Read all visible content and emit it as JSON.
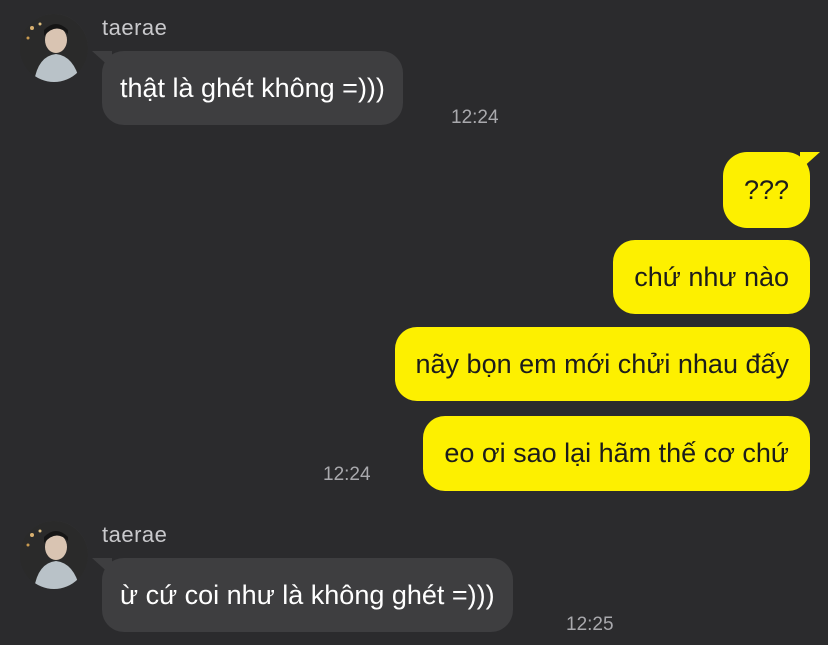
{
  "colors": {
    "background": "#2b2b2d",
    "incoming_bubble": "#3e3e40",
    "outgoing_bubble": "#fdf000"
  },
  "messages": {
    "group1": {
      "sender": "taerae",
      "avatar_icon": "profile-photo",
      "text": "thật là ghét không =)))",
      "time": "12:24"
    },
    "outgoing": {
      "items": [
        "???",
        "chứ như nào",
        "nãy bọn em mới chửi nhau đấy",
        "eo ơi sao lại hãm thế cơ chứ"
      ],
      "time": "12:24"
    },
    "group2": {
      "sender": "taerae",
      "avatar_icon": "profile-photo",
      "text": "ừ cứ coi như là không ghét =)))",
      "time": "12:25"
    }
  }
}
